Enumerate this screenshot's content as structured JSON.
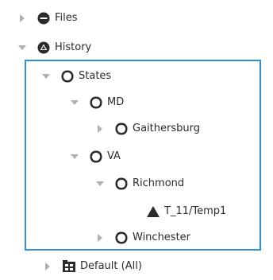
{
  "tree": {
    "files": {
      "label": "Files",
      "icon": "db-icon",
      "state": "collapsed"
    },
    "history": {
      "label": "History",
      "icon": "history-icon",
      "state": "expanded"
    },
    "states": {
      "label": "States",
      "icon": "folder-icon",
      "state": "expanded"
    },
    "md": {
      "label": "MD",
      "icon": "folder-icon",
      "state": "expanded"
    },
    "gaithersburg": {
      "label": "Gaithersburg",
      "icon": "folder-icon",
      "state": "collapsed"
    },
    "va": {
      "label": "VA",
      "icon": "folder-icon",
      "state": "expanded"
    },
    "richmond": {
      "label": "Richmond",
      "icon": "folder-icon",
      "state": "expanded"
    },
    "temp": {
      "label": "T_11/Temp1",
      "icon": "point-icon"
    },
    "winchester": {
      "label": "Winchester",
      "icon": "folder-icon",
      "state": "collapsed"
    },
    "default_all": {
      "label": "Default (All)",
      "icon": "grid-folder-icon",
      "state": "collapsed"
    }
  },
  "colors": {
    "selection_border": "#2f8fd8",
    "twisty": "#b0b0b0",
    "icon": "#2b2b2b"
  }
}
